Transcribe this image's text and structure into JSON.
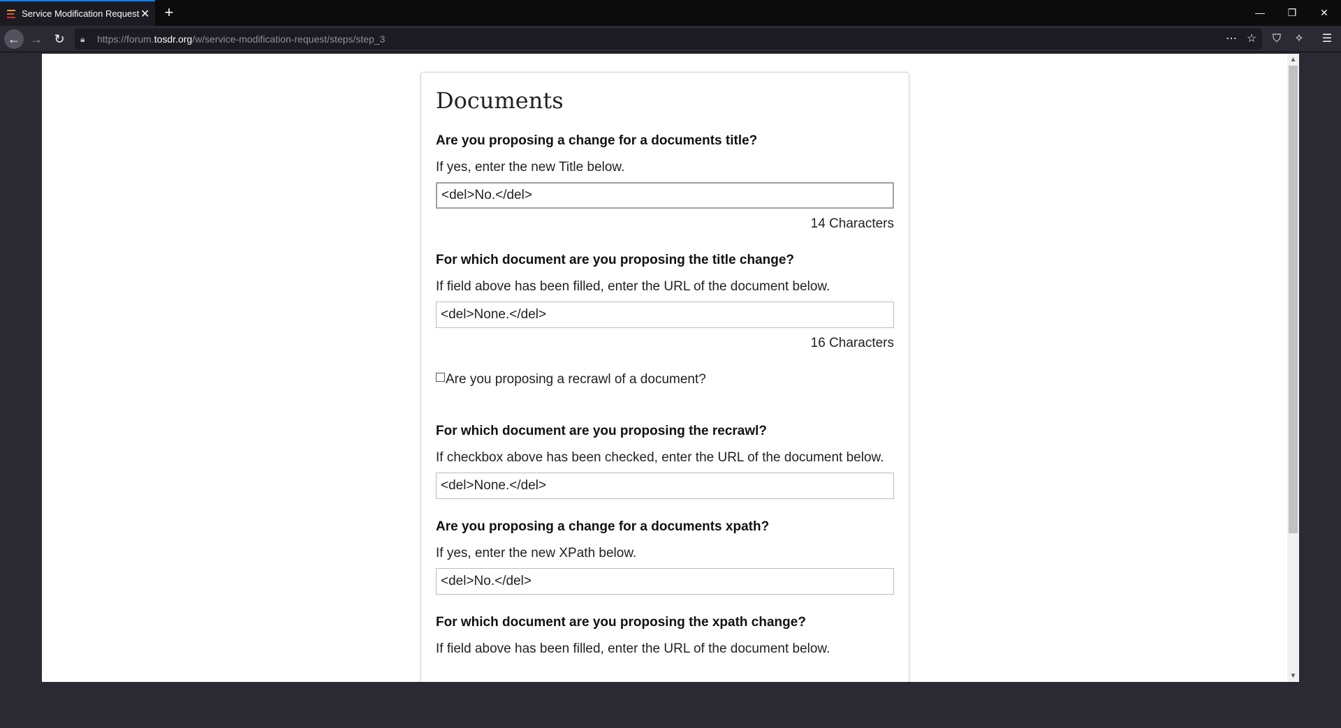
{
  "browser": {
    "tab_title": "Service Modification Request",
    "new_tab_symbol": "+",
    "url_prefix": "https://forum.",
    "url_host": "tosdr.org",
    "url_path": "/w/service-modification-request/steps/step_3"
  },
  "page": {
    "heading": "Documents",
    "sections": [
      {
        "question": "Are you proposing a change for a documents title?",
        "hint": "If yes, enter the new Title below.",
        "value": "<del>No.</del>",
        "count": "14 Characters"
      },
      {
        "question": "For which document are you proposing the title change?",
        "hint": "If field above has been filled, enter the URL of the document below.",
        "value": "<del>None.</del>",
        "count": "16 Characters"
      },
      {
        "checkbox_label": "Are you proposing a recrawl of a document?",
        "checked": false
      },
      {
        "question": "For which document are you proposing the recrawl?",
        "hint": "If checkbox above has been checked, enter the URL of the document below.",
        "value": "<del>None.</del>"
      },
      {
        "question": "Are you proposing a change for a documents xpath?",
        "hint": "If yes, enter the new XPath below.",
        "value": "<del>No.</del>"
      },
      {
        "question": "For which document are you proposing the xpath change?",
        "hint": "If field above has been filled, enter the URL of the document below."
      }
    ]
  },
  "colors": {
    "accent": "#0a84ff",
    "chrome_dark": "#0c0c0d",
    "toolbar": "#2b2a33"
  }
}
